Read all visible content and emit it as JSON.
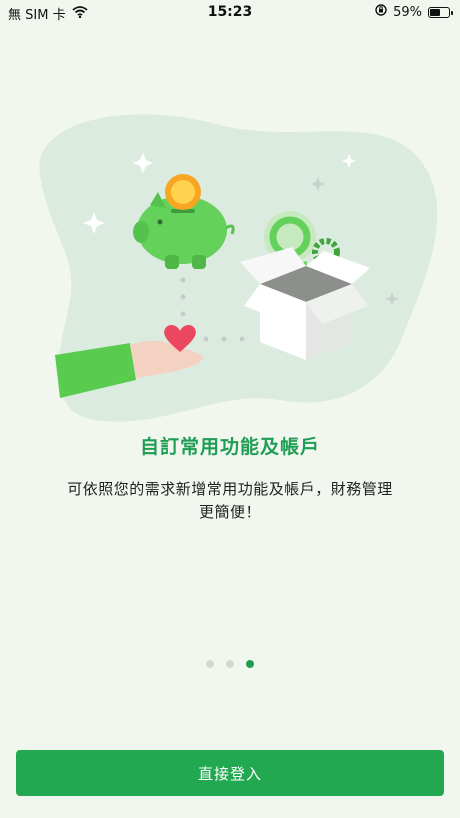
{
  "status_bar": {
    "carrier": "無 SIM 卡",
    "time": "15:23",
    "battery_percent": "59%",
    "battery_level": 0.59
  },
  "onboarding": {
    "title": "自訂常用功能及帳戶",
    "description": "可依照您的需求新增常用功能及帳戶，財務管理更簡便！",
    "page_count": 3,
    "active_page": 3
  },
  "login_button_label": "直接登入",
  "colors": {
    "accent": "#22a850",
    "title": "#1f9d55",
    "background": "#f1f7ee"
  }
}
